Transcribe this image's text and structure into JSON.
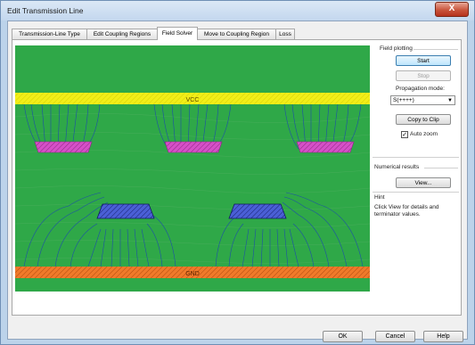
{
  "window": {
    "title": "Edit Transmission Line",
    "close_label": "X"
  },
  "tabs": [
    {
      "label": "Transmission-Line Type"
    },
    {
      "label": "Edit Coupling Regions"
    },
    {
      "label": "Field Solver"
    },
    {
      "label": "Move to Coupling Region"
    },
    {
      "label": "Loss"
    }
  ],
  "active_tab": "Field Solver",
  "field_view": {
    "vcc_label": "VCC",
    "gnd_label": "GND",
    "colors": {
      "background": "#2fa848",
      "vcc": "#f2ee19",
      "gnd": "#f07a2a",
      "trace_top": "#d64fc8",
      "trace_signal": "#4052c8",
      "field_line": "#1d4fa8"
    }
  },
  "field_plotting": {
    "label": "Field plotting",
    "start_label": "Start",
    "stop_label": "Stop",
    "propagation_label": "Propagation mode:",
    "propagation_value": "S(++++)",
    "copy_label": "Copy to Clip",
    "auto_zoom_label": "Auto zoom",
    "auto_zoom_checked": true
  },
  "numerical_results": {
    "label": "Numerical results",
    "view_label": "View..."
  },
  "hint": {
    "label": "Hint",
    "text_line1": "Click View for details and",
    "text_line2": "terminator values."
  },
  "footer": {
    "ok_label": "OK",
    "cancel_label": "Cancel",
    "help_label": "Help"
  }
}
